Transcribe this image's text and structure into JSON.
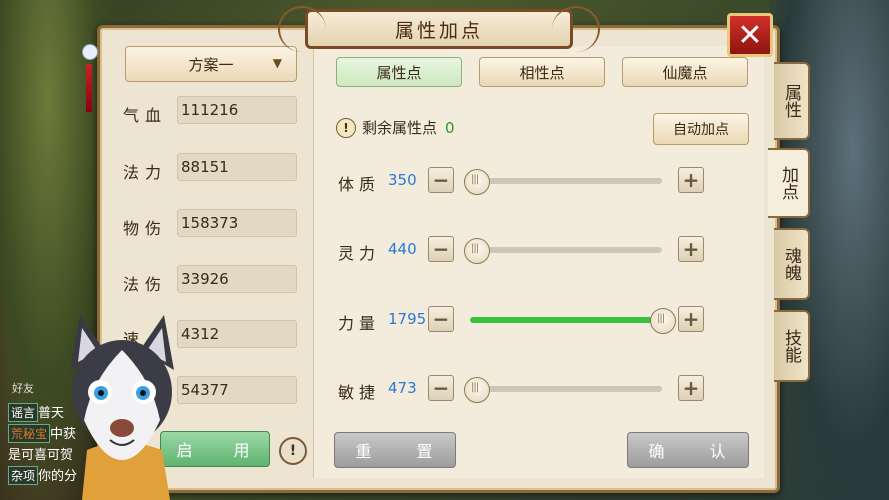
{
  "title": "属性加点",
  "close_label": "✕",
  "plan": {
    "selected": "方案一"
  },
  "stats": [
    {
      "label": "气血",
      "value": "111216"
    },
    {
      "label": "法力",
      "value": "88151"
    },
    {
      "label": "物伤",
      "value": "158373"
    },
    {
      "label": "法伤",
      "value": "33926"
    },
    {
      "label": "速",
      "value": "4312"
    },
    {
      "label": "",
      "value": "54377"
    }
  ],
  "enable_label": "启 用",
  "info_label": "!",
  "tabs": [
    {
      "label": "属性点",
      "active": true
    },
    {
      "label": "相性点",
      "active": false
    },
    {
      "label": "仙魔点",
      "active": false
    }
  ],
  "remaining": {
    "label": "剩余属性点",
    "value": "0"
  },
  "auto_label": "自动加点",
  "attributes": [
    {
      "label": "体质",
      "value": "350",
      "level": 0.0,
      "filled": false
    },
    {
      "label": "灵力",
      "value": "440",
      "level": 0.0,
      "filled": false
    },
    {
      "label": "力量",
      "value": "1795",
      "level": 1.0,
      "filled": true
    },
    {
      "label": "敏捷",
      "value": "473",
      "level": 0.0,
      "filled": false
    }
  ],
  "reset_label": "重 置",
  "confirm_label": "确 认",
  "side_tabs": [
    {
      "label": "属性",
      "active": false
    },
    {
      "label": "加点",
      "active": true
    },
    {
      "label": "魂魄",
      "active": false
    },
    {
      "label": "技能",
      "active": false
    }
  ],
  "chat": {
    "friend_label": "好友",
    "lines": [
      {
        "tag": "谣言",
        "text": "普天"
      },
      {
        "tag": "荒秘宝",
        "text": "中获"
      },
      {
        "tag": "",
        "text": "是可喜可贺"
      },
      {
        "tag": "杂项",
        "text": "你的分"
      }
    ]
  },
  "colors": {
    "accent_green": "#3cbf3c",
    "value_blue": "#2a7ad6",
    "close_red": "#c0261f"
  }
}
